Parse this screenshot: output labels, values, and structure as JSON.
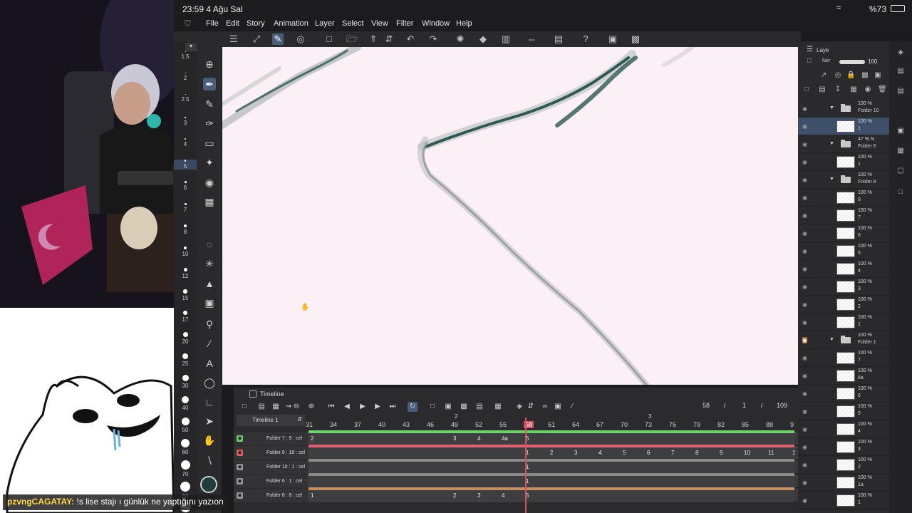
{
  "status_bar": {
    "time_date": "23:59  4 Ağu Sal",
    "battery": "%73"
  },
  "menu": {
    "items": [
      "File",
      "Edit",
      "Story",
      "Animation",
      "Layer",
      "Select",
      "View",
      "Filter",
      "Window",
      "Help"
    ]
  },
  "brush_sizes": [
    "1.5",
    "2",
    "2.5",
    "3",
    "4",
    "5",
    "6",
    "7",
    "8",
    "10",
    "12",
    "15",
    "17",
    "20",
    "25",
    "30",
    "40",
    "50",
    "60",
    "70",
    "80",
    "100"
  ],
  "active_brush_size": "5",
  "timeline": {
    "title": "Timeline",
    "name": "Timeline 1",
    "current_frame": "58",
    "sep1": "/",
    "page": "1",
    "sep2": "/",
    "total_frames": "109",
    "marker_left": "2",
    "marker_right": "3",
    "frame_numbers": [
      "31",
      "34",
      "37",
      "40",
      "43",
      "46",
      "49",
      "52",
      "55",
      "58",
      "61",
      "64",
      "67",
      "70",
      "73",
      "76",
      "79",
      "82",
      "85",
      "88",
      "9"
    ],
    "tracks": [
      {
        "label": "Folder 7 : 9 : cel",
        "cels": [
          "2",
          "3",
          "4",
          "4a",
          "5"
        ]
      },
      {
        "label": "Folder 9 : 16 : cel",
        "cels": [
          "1",
          "2",
          "3",
          "4",
          "5",
          "6",
          "7",
          "8",
          "9",
          "10",
          "11",
          "1"
        ]
      },
      {
        "label": "Folder 10 : 1 : cel",
        "cels": [
          "1"
        ]
      },
      {
        "label": "Folder 6 : 1 : cel",
        "cels": [
          "1"
        ]
      },
      {
        "label": "Folder 8 : 8 : cel",
        "cels": [
          "1",
          "2",
          "3",
          "4",
          "5"
        ]
      }
    ]
  },
  "layer_panel": {
    "tab": "Laye",
    "blend_mode": "Nor",
    "opacity": "100",
    "layers": [
      {
        "pct": "100 %",
        "name": "Folder 10",
        "folder": true
      },
      {
        "pct": "100 %",
        "name": "1",
        "folder": false,
        "selected": true
      },
      {
        "pct": "47 % N",
        "name": "Folder 6",
        "folder": true
      },
      {
        "pct": "100 %",
        "name": "1",
        "folder": false
      },
      {
        "pct": "100 %",
        "name": "Folder 8",
        "folder": true
      },
      {
        "pct": "100 %",
        "name": "8",
        "folder": false
      },
      {
        "pct": "100 %",
        "name": "7",
        "folder": false
      },
      {
        "pct": "100 %",
        "name": "6",
        "folder": false
      },
      {
        "pct": "100 %",
        "name": "5",
        "folder": false
      },
      {
        "pct": "100 %",
        "name": "4",
        "folder": false
      },
      {
        "pct": "100 %",
        "name": "3",
        "folder": false
      },
      {
        "pct": "100 %",
        "name": "2",
        "folder": false
      },
      {
        "pct": "100 %",
        "name": "1",
        "folder": false
      },
      {
        "pct": "100 %",
        "name": "Folder 1",
        "folder": true,
        "highlight": true
      },
      {
        "pct": "100 %",
        "name": "7",
        "folder": false
      },
      {
        "pct": "100 %",
        "name": "6a",
        "folder": false
      },
      {
        "pct": "100 %",
        "name": "6",
        "folder": false
      },
      {
        "pct": "100 %",
        "name": "5",
        "folder": false
      },
      {
        "pct": "100 %",
        "name": "4",
        "folder": false
      },
      {
        "pct": "100 %",
        "name": "3",
        "folder": false
      },
      {
        "pct": "100 %",
        "name": "2",
        "folder": false
      },
      {
        "pct": "100 %",
        "name": "1a",
        "folder": false
      },
      {
        "pct": "100 %",
        "name": "1",
        "folder": false
      }
    ]
  },
  "chat": {
    "user": "pzvngCAGATAY:",
    "message": " !s lise stajı ı günlük ne yaptığını yazıon"
  },
  "colors": {
    "canvas_bg": "#fbf0f6",
    "stroke": "#2d5a55",
    "accent": "#4a5d7a",
    "playhead": "#d54f5d",
    "primary_color": "#1f3d3a"
  },
  "icons": {
    "command_bar": [
      "menu-icon",
      "resize-icon",
      "edit-icon",
      "onion-skin-icon",
      "new-file-icon",
      "open-folder-icon",
      "save-icon",
      "undo-icon",
      "redo-icon",
      "loading-icon",
      "fill-icon",
      "crop-icon",
      "flip-icon",
      "page-icon",
      "help-icon",
      "settings-icon"
    ],
    "tools": [
      "move-icon",
      "pen-icon",
      "pencil-icon",
      "brush-icon",
      "eraser-icon",
      "blend-icon",
      "fill-bucket-icon",
      "lasso-icon",
      "magic-wand-icon",
      "gradient-icon",
      "zoom-icon",
      "line-icon",
      "text-icon",
      "balloon-icon",
      "ruler-icon",
      "object-icon",
      "hand-icon",
      "eyedropper-icon"
    ]
  }
}
